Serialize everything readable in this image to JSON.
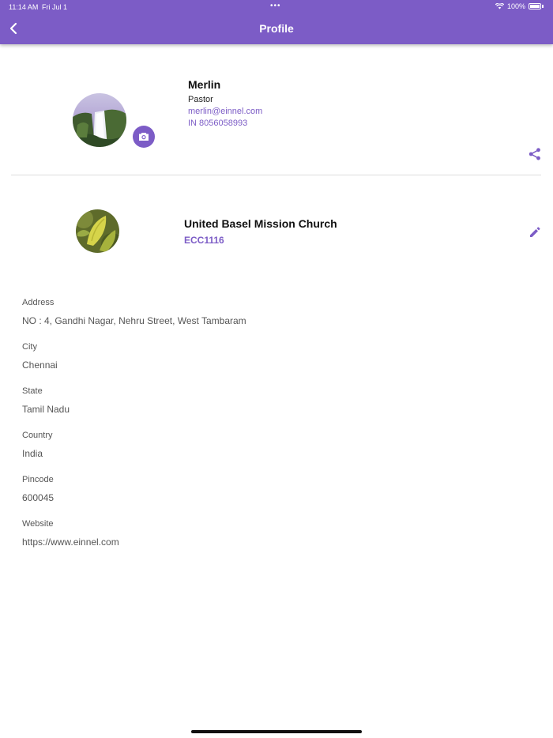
{
  "status_bar": {
    "time": "11:14 AM",
    "date": "Fri Jul 1",
    "battery": "100%"
  },
  "header": {
    "title": "Profile",
    "back_icon": "chevron-left-icon",
    "background": "#7c5cc6"
  },
  "user": {
    "name": "Merlin",
    "role": "Pastor",
    "email": "merlin@einnel.com",
    "phone": "IN 8056058993",
    "avatar_icon": "waterfall-photo",
    "camera_icon": "camera-icon",
    "share_icon": "share-icon"
  },
  "church": {
    "name": "United Basel Mission Church",
    "code": "ECC1116",
    "logo_icon": "leaf-photo",
    "edit_icon": "pencil-icon"
  },
  "details": {
    "address_label": "Address",
    "address": "NO : 4, Gandhi Nagar, Nehru Street, West Tambaram",
    "city_label": "City",
    "city": "Chennai",
    "state_label": "State",
    "state": "Tamil Nadu",
    "country_label": "Country",
    "country": "India",
    "pincode_label": "Pincode",
    "pincode": "600045",
    "website_label": "Website",
    "website": "https://www.einnel.com"
  },
  "colors": {
    "accent": "#7c5cc6",
    "text": "#555555",
    "divider": "#dcdcdc"
  }
}
